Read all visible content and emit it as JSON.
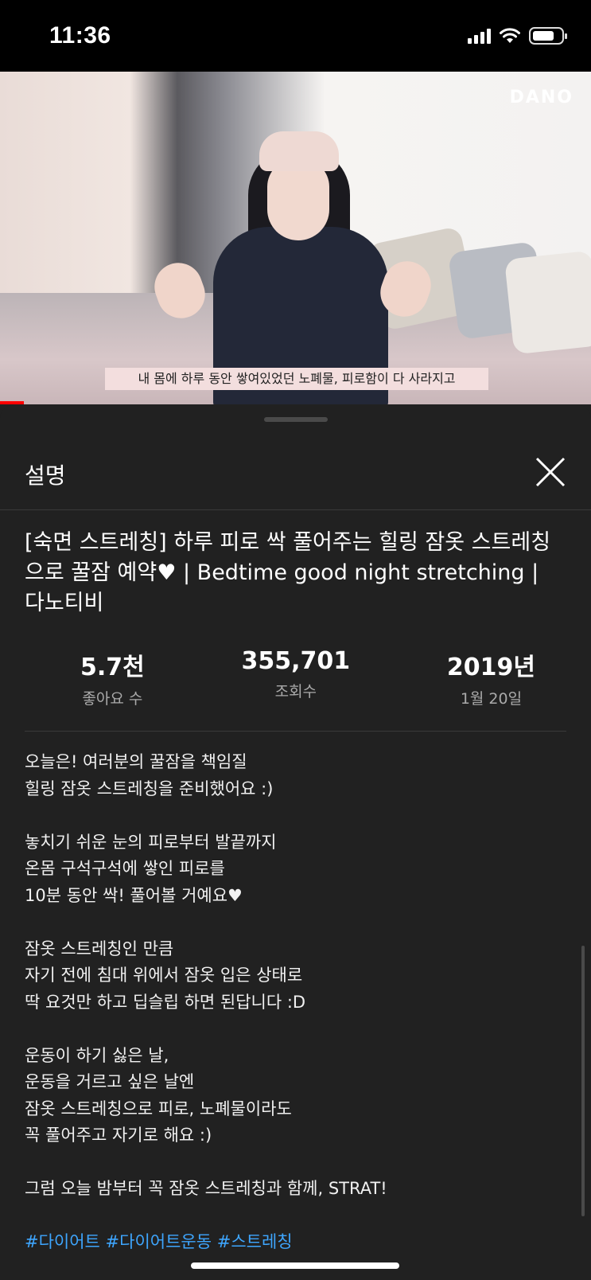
{
  "status_bar": {
    "time": "11:36",
    "battery_level": 0.75
  },
  "video": {
    "watermark": "DANO",
    "subtitle": "내 몸에 하루 동안 쌓여있었던 노폐물, 피로함이 다 사라지고",
    "progress": 0.04
  },
  "sheet": {
    "title": "설명",
    "video_title": "[숙면 스트레칭] 하루 피로 싹 풀어주는 힐링 잠옷 스트레칭으로 꿀잠 예약♥ | Bedtime good night stretching | 다노티비",
    "stats": [
      {
        "value": "5.7천",
        "label": "좋아요 수"
      },
      {
        "value": "355,701",
        "label": "조회수"
      },
      {
        "value": "2019년",
        "label": "1월 20일"
      }
    ],
    "description": [
      "오늘은! 여러분의 꿀잠을 책임질",
      "힐링 잠옷 스트레칭을 준비했어요 :)",
      "",
      "놓치기 쉬운 눈의 피로부터 발끝까지",
      "온몸 구석구석에 쌓인 피로를",
      "10분 동안 싹! 풀어볼 거예요♥",
      "",
      "잠옷 스트레칭인 만큼",
      "자기 전에 침대 위에서 잠옷 입은 상태로",
      "딱 요것만 하고 딥슬립 하면 된답니다 :D",
      "",
      "운동이 하기 싫은 날,",
      "운동을 거르고 싶은 날엔",
      "잠옷 스트레칭으로 피로, 노폐물이라도",
      "꼭 풀어주고 자기로 해요 :)",
      "",
      "그럼 오늘 밤부터 꼭 잠옷 스트레칭과 함께, STRAT!",
      ""
    ],
    "hashtags": "#다이어트 #다이어트운동 #스트레칭"
  }
}
